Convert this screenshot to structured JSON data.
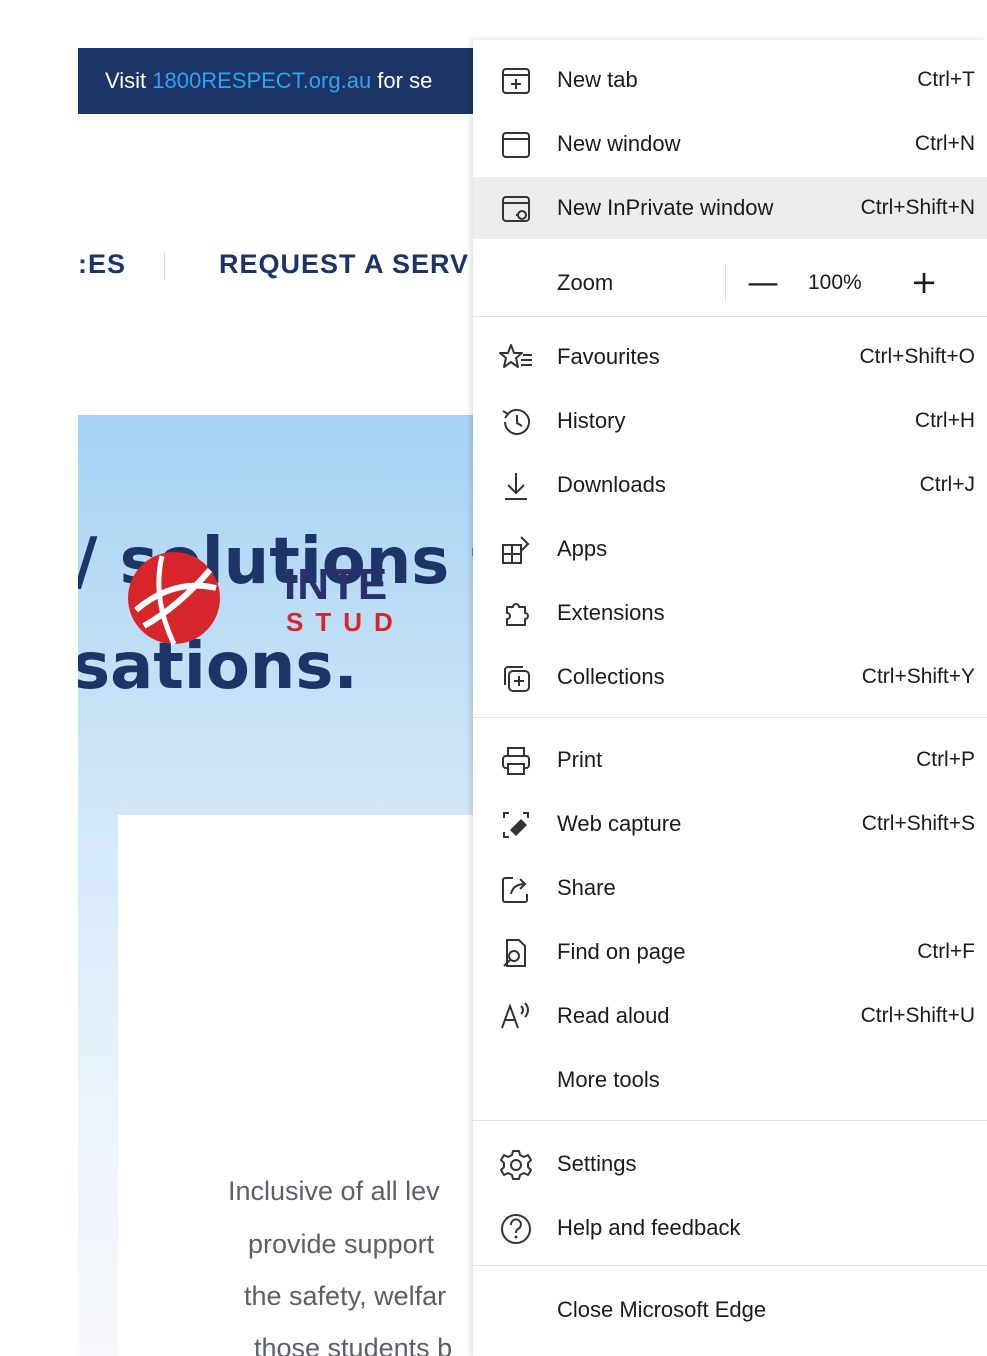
{
  "page": {
    "banner": {
      "prefix": "Visit ",
      "link": "1800RESPECT.org.au",
      "suffix": " for se"
    },
    "nav": {
      "item_partial": ":ES",
      "request": "REQUEST A SERV"
    },
    "hero": {
      "line1": "/ solutions t",
      "line2": "sations."
    },
    "logo": {
      "line1": "INTE",
      "line2": "STUD"
    },
    "paragraph": [
      "Inclusive of all lev",
      "provide support",
      "the safety, welfar",
      "those students b"
    ],
    "colors": {
      "banner_bg": "#1d3566",
      "banner_link": "#2ea3f2",
      "heading": "#1d3566",
      "logo_red": "#d6262b"
    }
  },
  "menu": {
    "items": [
      {
        "id": "new-tab",
        "label": "New tab",
        "shortcut": "Ctrl+T",
        "icon": "new-tab-icon"
      },
      {
        "id": "new-window",
        "label": "New window",
        "shortcut": "Ctrl+N",
        "icon": "new-window-icon"
      },
      {
        "id": "new-inprivate-window",
        "label": "New InPrivate window",
        "shortcut": "Ctrl+Shift+N",
        "icon": "inprivate-icon",
        "highlighted": true
      },
      {
        "id": "favourites",
        "label": "Favourites",
        "shortcut": "Ctrl+Shift+O",
        "icon": "favourites-icon"
      },
      {
        "id": "history",
        "label": "History",
        "shortcut": "Ctrl+H",
        "icon": "history-icon"
      },
      {
        "id": "downloads",
        "label": "Downloads",
        "shortcut": "Ctrl+J",
        "icon": "download-icon"
      },
      {
        "id": "apps",
        "label": "Apps",
        "shortcut": "",
        "icon": "apps-icon"
      },
      {
        "id": "extensions",
        "label": "Extensions",
        "shortcut": "",
        "icon": "extensions-icon"
      },
      {
        "id": "collections",
        "label": "Collections",
        "shortcut": "Ctrl+Shift+Y",
        "icon": "collections-icon"
      },
      {
        "id": "print",
        "label": "Print",
        "shortcut": "Ctrl+P",
        "icon": "print-icon"
      },
      {
        "id": "web-capture",
        "label": "Web capture",
        "shortcut": "Ctrl+Shift+S",
        "icon": "web-capture-icon"
      },
      {
        "id": "share",
        "label": "Share",
        "shortcut": "",
        "icon": "share-icon"
      },
      {
        "id": "find-on-page",
        "label": "Find on page",
        "shortcut": "Ctrl+F",
        "icon": "find-icon"
      },
      {
        "id": "read-aloud",
        "label": "Read aloud",
        "shortcut": "Ctrl+Shift+U",
        "icon": "read-aloud-icon"
      },
      {
        "id": "more-tools",
        "label": "More tools",
        "shortcut": "",
        "icon": ""
      },
      {
        "id": "settings",
        "label": "Settings",
        "shortcut": "",
        "icon": "gear-icon"
      },
      {
        "id": "help-feedback",
        "label": "Help and feedback",
        "shortcut": "",
        "icon": "help-icon"
      },
      {
        "id": "close-edge",
        "label": "Close Microsoft Edge",
        "shortcut": "",
        "icon": ""
      }
    ],
    "zoom": {
      "label": "Zoom",
      "value": "100%",
      "minus": "—",
      "plus": "+"
    },
    "colors": {
      "highlight_bg": "#ececec",
      "divider": "#e1e1e1",
      "text": "#1b1b1b"
    }
  }
}
